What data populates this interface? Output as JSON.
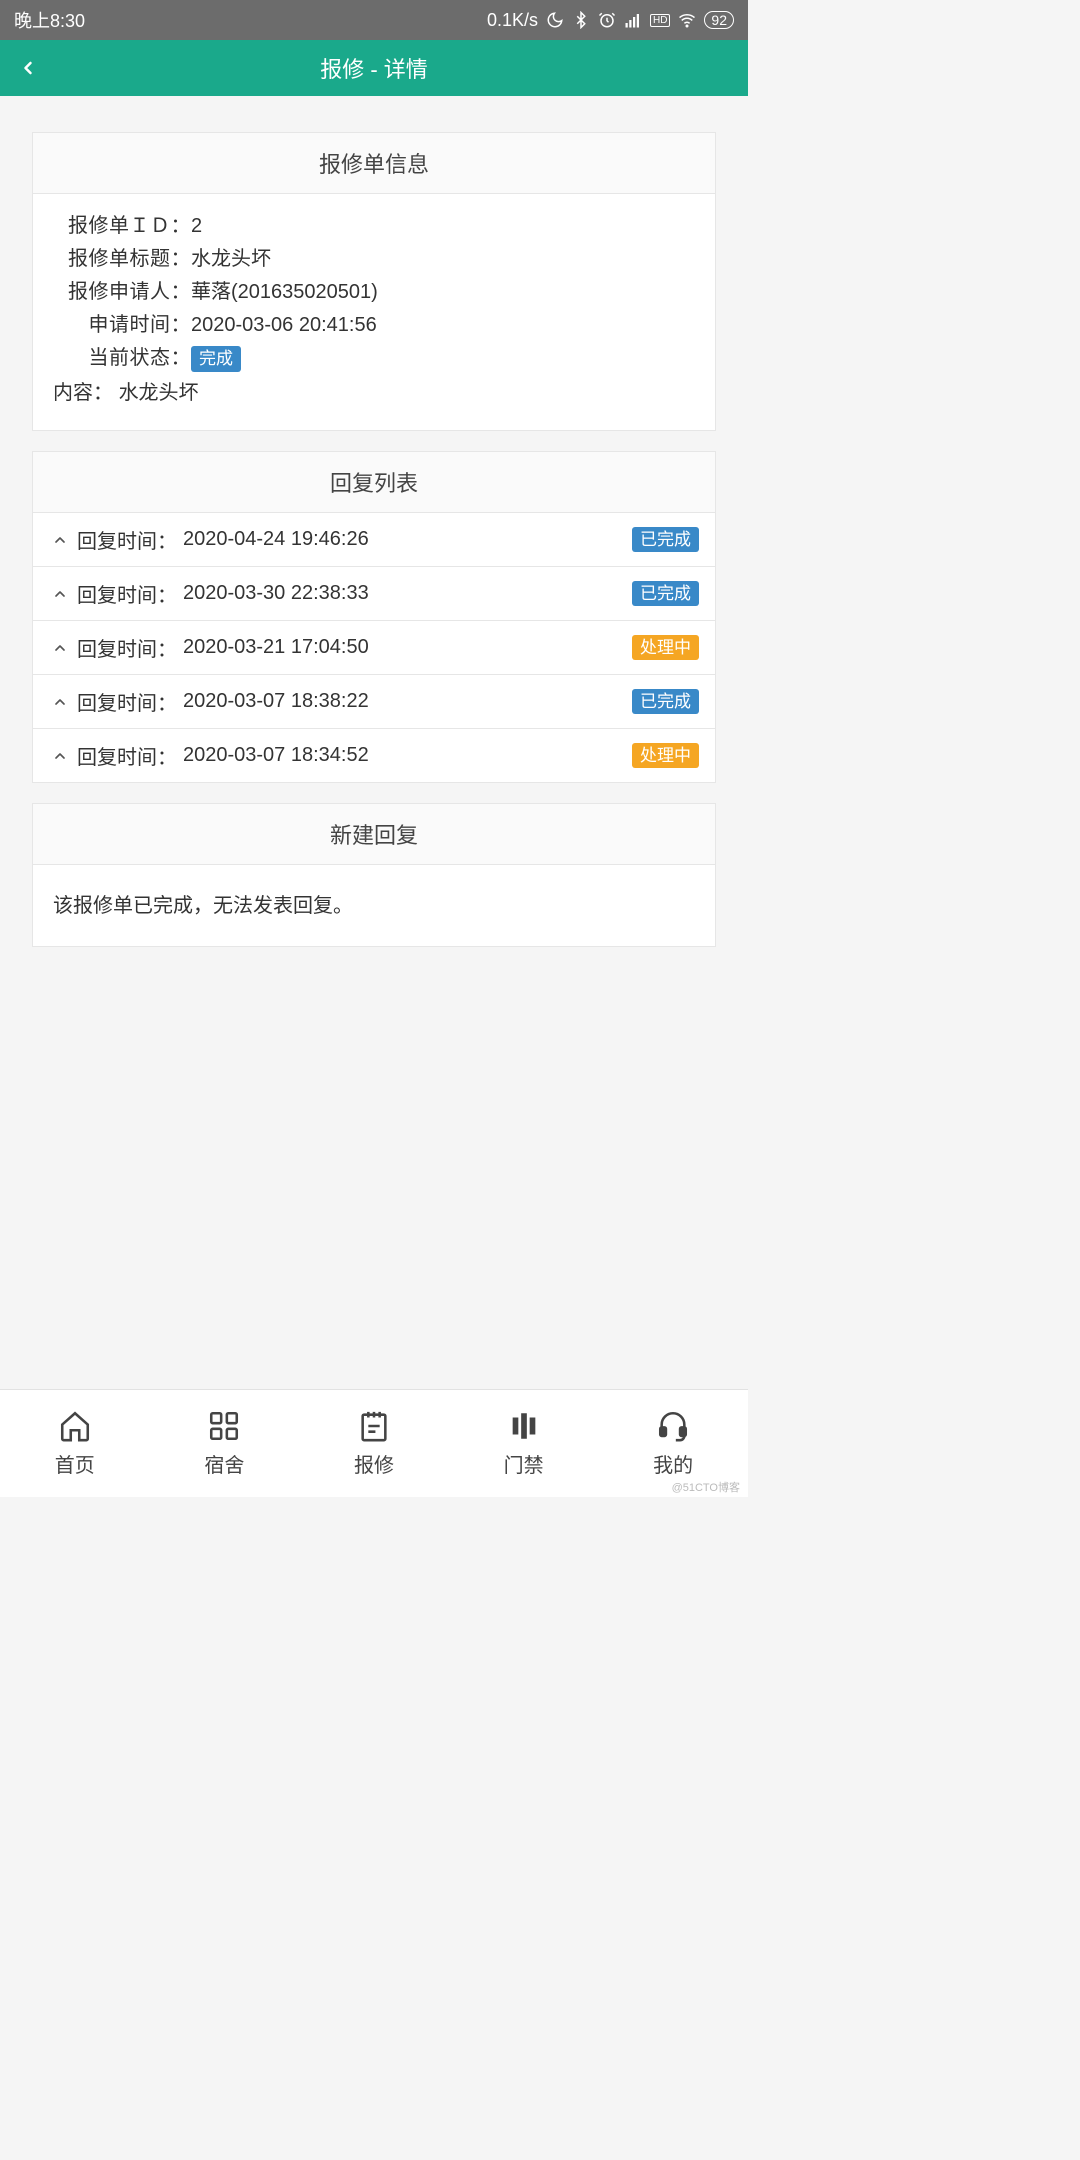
{
  "statusbar": {
    "time": "晚上8:30",
    "speed": "0.1K/s",
    "battery": "92"
  },
  "appbar": {
    "title": "报修 - 详情"
  },
  "info": {
    "header": "报修单信息",
    "id_label": "报修单ＩＤ：",
    "id_value": "2",
    "title_label": "报修单标题：",
    "title_value": "水龙头坏",
    "applicant_label": "报修申请人：",
    "applicant_value": "華落(201635020501)",
    "apply_time_label": "申请时间：",
    "apply_time_value": "2020-03-06 20:41:56",
    "status_label": "当前状态：",
    "status_value": "完成",
    "content_label": "内容：",
    "content_value": "水龙头坏"
  },
  "replies": {
    "header": "回复列表",
    "time_label": "回复时间：",
    "status_done": "已完成",
    "status_processing": "处理中",
    "items": [
      {
        "time": "2020-04-24 19:46:26",
        "status": "done"
      },
      {
        "time": "2020-03-30 22:38:33",
        "status": "done"
      },
      {
        "time": "2020-03-21 17:04:50",
        "status": "processing"
      },
      {
        "time": "2020-03-07 18:38:22",
        "status": "done"
      },
      {
        "time": "2020-03-07 18:34:52",
        "status": "processing"
      }
    ]
  },
  "newreply": {
    "header": "新建回复",
    "message": "该报修单已完成，无法发表回复。"
  },
  "nav": {
    "home": "首页",
    "dorm": "宿舍",
    "repair": "报修",
    "access": "门禁",
    "mine": "我的"
  },
  "watermark": "@51CTO博客"
}
